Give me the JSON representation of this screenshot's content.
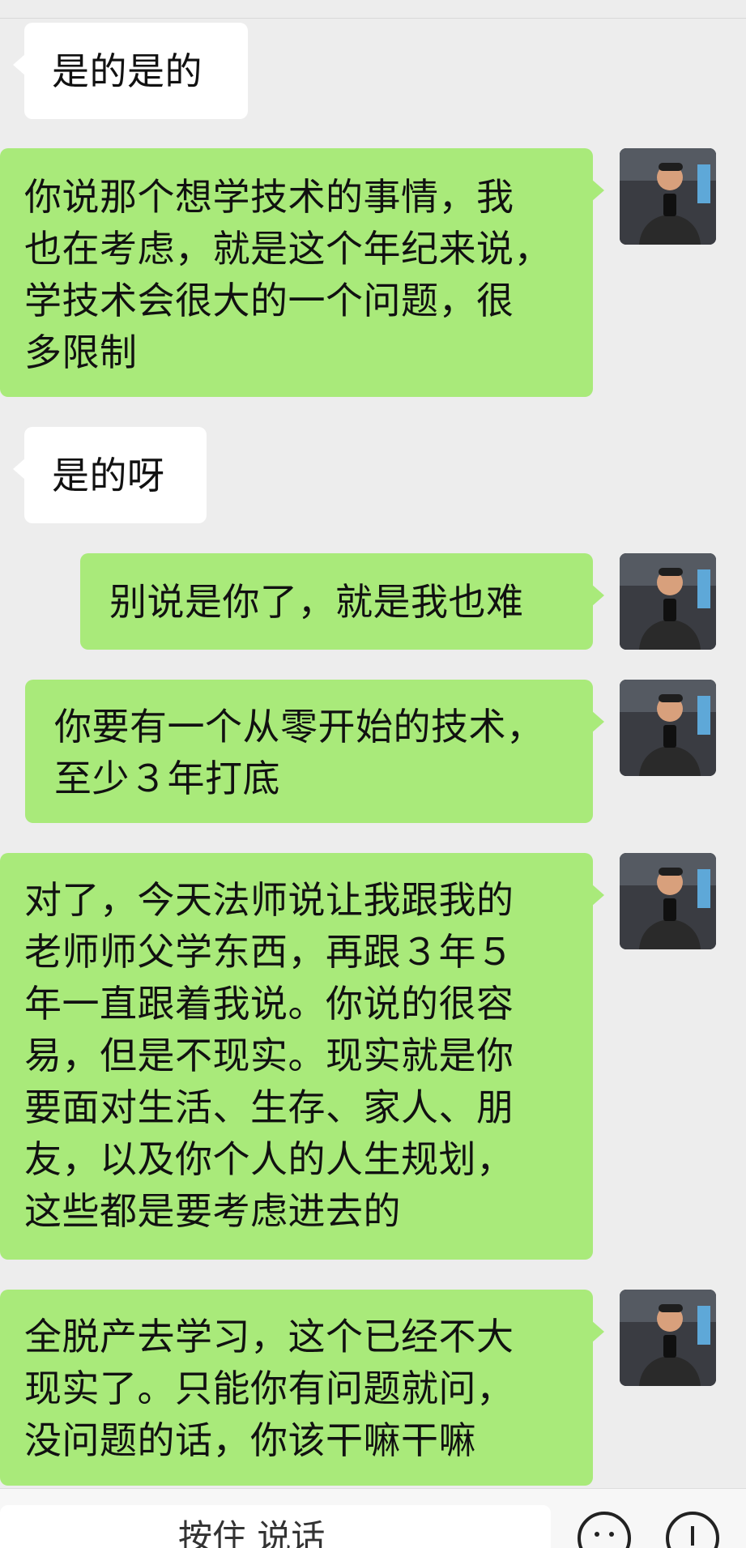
{
  "messages": [
    {
      "side": "incoming",
      "text": "是的是的"
    },
    {
      "side": "outgoing",
      "text": "你说那个想学技术的事情，我\n也在考虑，就是这个年纪来说，\n学技术会很大的一个问题，很\n多限制"
    },
    {
      "side": "incoming",
      "text": "是的呀"
    },
    {
      "side": "outgoing",
      "text": "别说是你了，就是我也难"
    },
    {
      "side": "outgoing",
      "text": "你要有一个从零开始的技术，\n至少３年打底"
    },
    {
      "side": "outgoing",
      "text": "对了，今天法师说让我跟我的\n老师师父学东西，再跟３年５\n年一直跟着我说。你说的很容\n易，但是不现实。现实就是你\n要面对生活、生存、家人、朋\n友，以及你个人的人生规划，\n这些都是要考虑进去的"
    },
    {
      "side": "outgoing",
      "text": "全脱产去学习，这个已经不大\n现实了。只能你有问题就问，\n没问题的话，你该干嘛干嘛"
    }
  ],
  "input_bar": {
    "voice_label": "按住 说话",
    "emoji_icon": "emoji-icon",
    "plus_icon": "plus-icon"
  },
  "colors": {
    "background": "#ededed",
    "incoming_bubble": "#ffffff",
    "outgoing_bubble": "#a9ea7a"
  }
}
